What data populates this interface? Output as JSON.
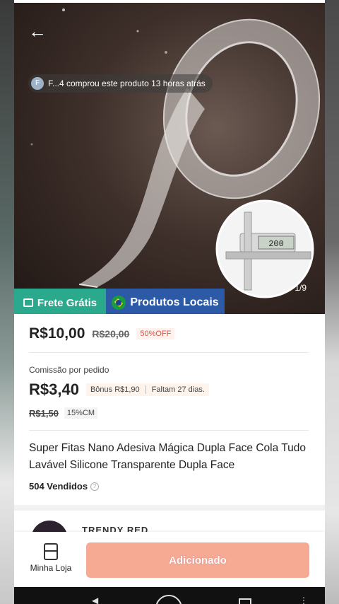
{
  "hero": {
    "toast_avatar": "F",
    "toast_text": "F...4 comprou este produto 13 horas atrás",
    "counter": "1/9",
    "caliper_reading": "200"
  },
  "badges": {
    "free_shipping": "Frete Grátis",
    "local_products": "Produtos Locais"
  },
  "price": {
    "current": "R$10,00",
    "original": "R$20,00",
    "discount": "50%OFF"
  },
  "commission": {
    "label": "Comissão por pedido",
    "amount": "R$3,40",
    "bonus": "Bônus R$1,90",
    "remaining": "Faltam 27 dias.",
    "old_amount": "R$1,50",
    "rate": "15%CM"
  },
  "product": {
    "title": "Super Fitas Nano Adesiva Mágica Dupla Face Cola Tudo Lavável Silicone Transparente Dupla Face",
    "sold": "504 Vendidos"
  },
  "shop": {
    "name": "TRENDY RED"
  },
  "bottom_bar": {
    "store_label": "Minha Loja",
    "add_button": "Adicionado"
  },
  "colors": {
    "free_shipping_bg": "#2aa98d",
    "local_products_bg": "#2d5aa6",
    "add_button_bg": "#f6a993",
    "discount_text": "#e0533d"
  }
}
